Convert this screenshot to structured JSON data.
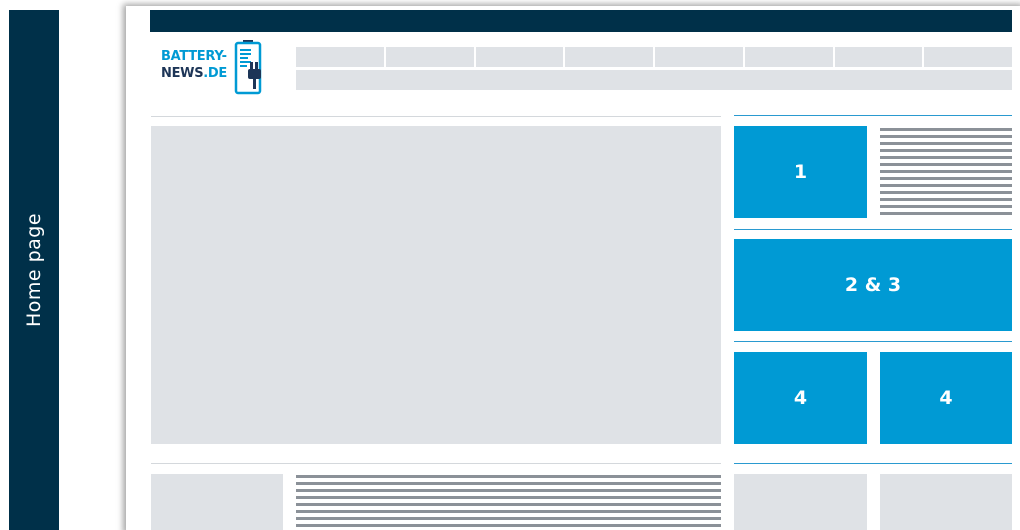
{
  "side_label": "Home page",
  "logo": {
    "line1": "BATTERY-",
    "line2_main": "NEWS",
    "line2_accent": ".DE",
    "icon": "battery-plug-icon"
  },
  "navigation": {
    "segments": 8
  },
  "tiles": [
    {
      "label": "1"
    },
    {
      "label": "2 & 3"
    },
    {
      "label": "4"
    },
    {
      "label": "4"
    }
  ],
  "colors": {
    "dark_navy": "#003049",
    "accent_blue": "#009ad4",
    "placeholder_grey": "#dfe2e6",
    "text_line_grey": "#8b9198"
  }
}
